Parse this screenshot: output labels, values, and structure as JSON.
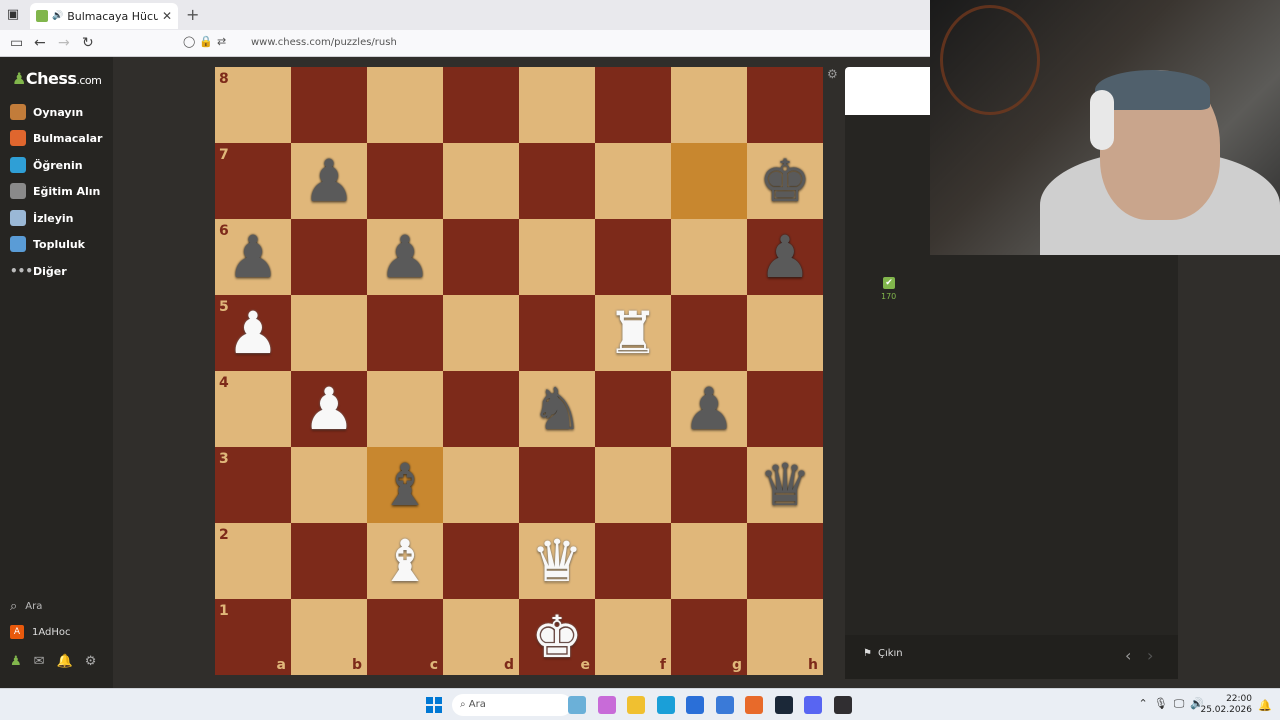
{
  "browser": {
    "tab_title": "Bulmacaya Hücum - Satranç",
    "url": "www.chess.com/puzzles/rush"
  },
  "sidebar": {
    "logo_main": "Chess",
    "logo_suffix": ".com",
    "items": [
      {
        "label": "Oynayın",
        "color": "#c27c3a"
      },
      {
        "label": "Bulmacalar",
        "color": "#e0662e"
      },
      {
        "label": "Öğrenin",
        "color": "#2f9fd6"
      },
      {
        "label": "Eğitim Alın",
        "color": "#8a8a8a"
      },
      {
        "label": "İzleyin",
        "color": "#9ab8d6"
      },
      {
        "label": "Topluluk",
        "color": "#5a9cd6"
      },
      {
        "label": "Diğer",
        "color": "#bbbbbb"
      }
    ],
    "search_label": "Ara",
    "user_initial": "A",
    "username": "1AdHoc"
  },
  "board": {
    "ranks": [
      "8",
      "7",
      "6",
      "5",
      "4",
      "3",
      "2",
      "1"
    ],
    "files": [
      "a",
      "b",
      "c",
      "d",
      "e",
      "f",
      "g",
      "h"
    ],
    "highlights": [
      "g7",
      "c3"
    ],
    "pieces": [
      {
        "sq": "b7",
        "color": "b",
        "glyph": "♟",
        "name": "black-pawn"
      },
      {
        "sq": "h7",
        "color": "b",
        "glyph": "♚",
        "name": "black-king"
      },
      {
        "sq": "a6",
        "color": "b",
        "glyph": "♟",
        "name": "black-pawn"
      },
      {
        "sq": "c6",
        "color": "b",
        "glyph": "♟",
        "name": "black-pawn"
      },
      {
        "sq": "h6",
        "color": "b",
        "glyph": "♟",
        "name": "black-pawn"
      },
      {
        "sq": "a5",
        "color": "w",
        "glyph": "♟",
        "name": "white-pawn"
      },
      {
        "sq": "f5",
        "color": "w",
        "glyph": "♜",
        "name": "white-rook"
      },
      {
        "sq": "b4",
        "color": "w",
        "glyph": "♟",
        "name": "white-pawn"
      },
      {
        "sq": "e4",
        "color": "b",
        "glyph": "♞",
        "name": "black-knight"
      },
      {
        "sq": "g4",
        "color": "b",
        "glyph": "♟",
        "name": "black-pawn"
      },
      {
        "sq": "c3",
        "color": "b",
        "glyph": "♝",
        "name": "black-bishop"
      },
      {
        "sq": "h3",
        "color": "b",
        "glyph": "♛",
        "name": "black-queen"
      },
      {
        "sq": "c2",
        "color": "w",
        "glyph": "♝",
        "name": "white-bishop"
      },
      {
        "sq": "e2",
        "color": "w",
        "glyph": "♛",
        "name": "white-queen"
      },
      {
        "sq": "e1",
        "color": "w",
        "glyph": "♚",
        "name": "white-king"
      }
    ]
  },
  "panel": {
    "score_check": "✔",
    "score": "170",
    "exit_label": "Çıkın"
  },
  "taskbar": {
    "search_label": "Ara",
    "time": "22:00",
    "date": "25.02.2026",
    "apps": [
      {
        "name": "widgets-app",
        "color": "#6bb0d8"
      },
      {
        "name": "photos-app",
        "color": "#c86bd8"
      },
      {
        "name": "explorer-app",
        "color": "#f0c030"
      },
      {
        "name": "edge-app",
        "color": "#1a9fd8"
      },
      {
        "name": "store-app",
        "color": "#2a6fd8"
      },
      {
        "name": "outlook-app",
        "color": "#3a7ad8"
      },
      {
        "name": "firefox-app",
        "color": "#e86a2a"
      },
      {
        "name": "steam-app",
        "color": "#1b2838"
      },
      {
        "name": "discord-app",
        "color": "#5865f2"
      },
      {
        "name": "obs-app",
        "color": "#302e31"
      }
    ]
  }
}
